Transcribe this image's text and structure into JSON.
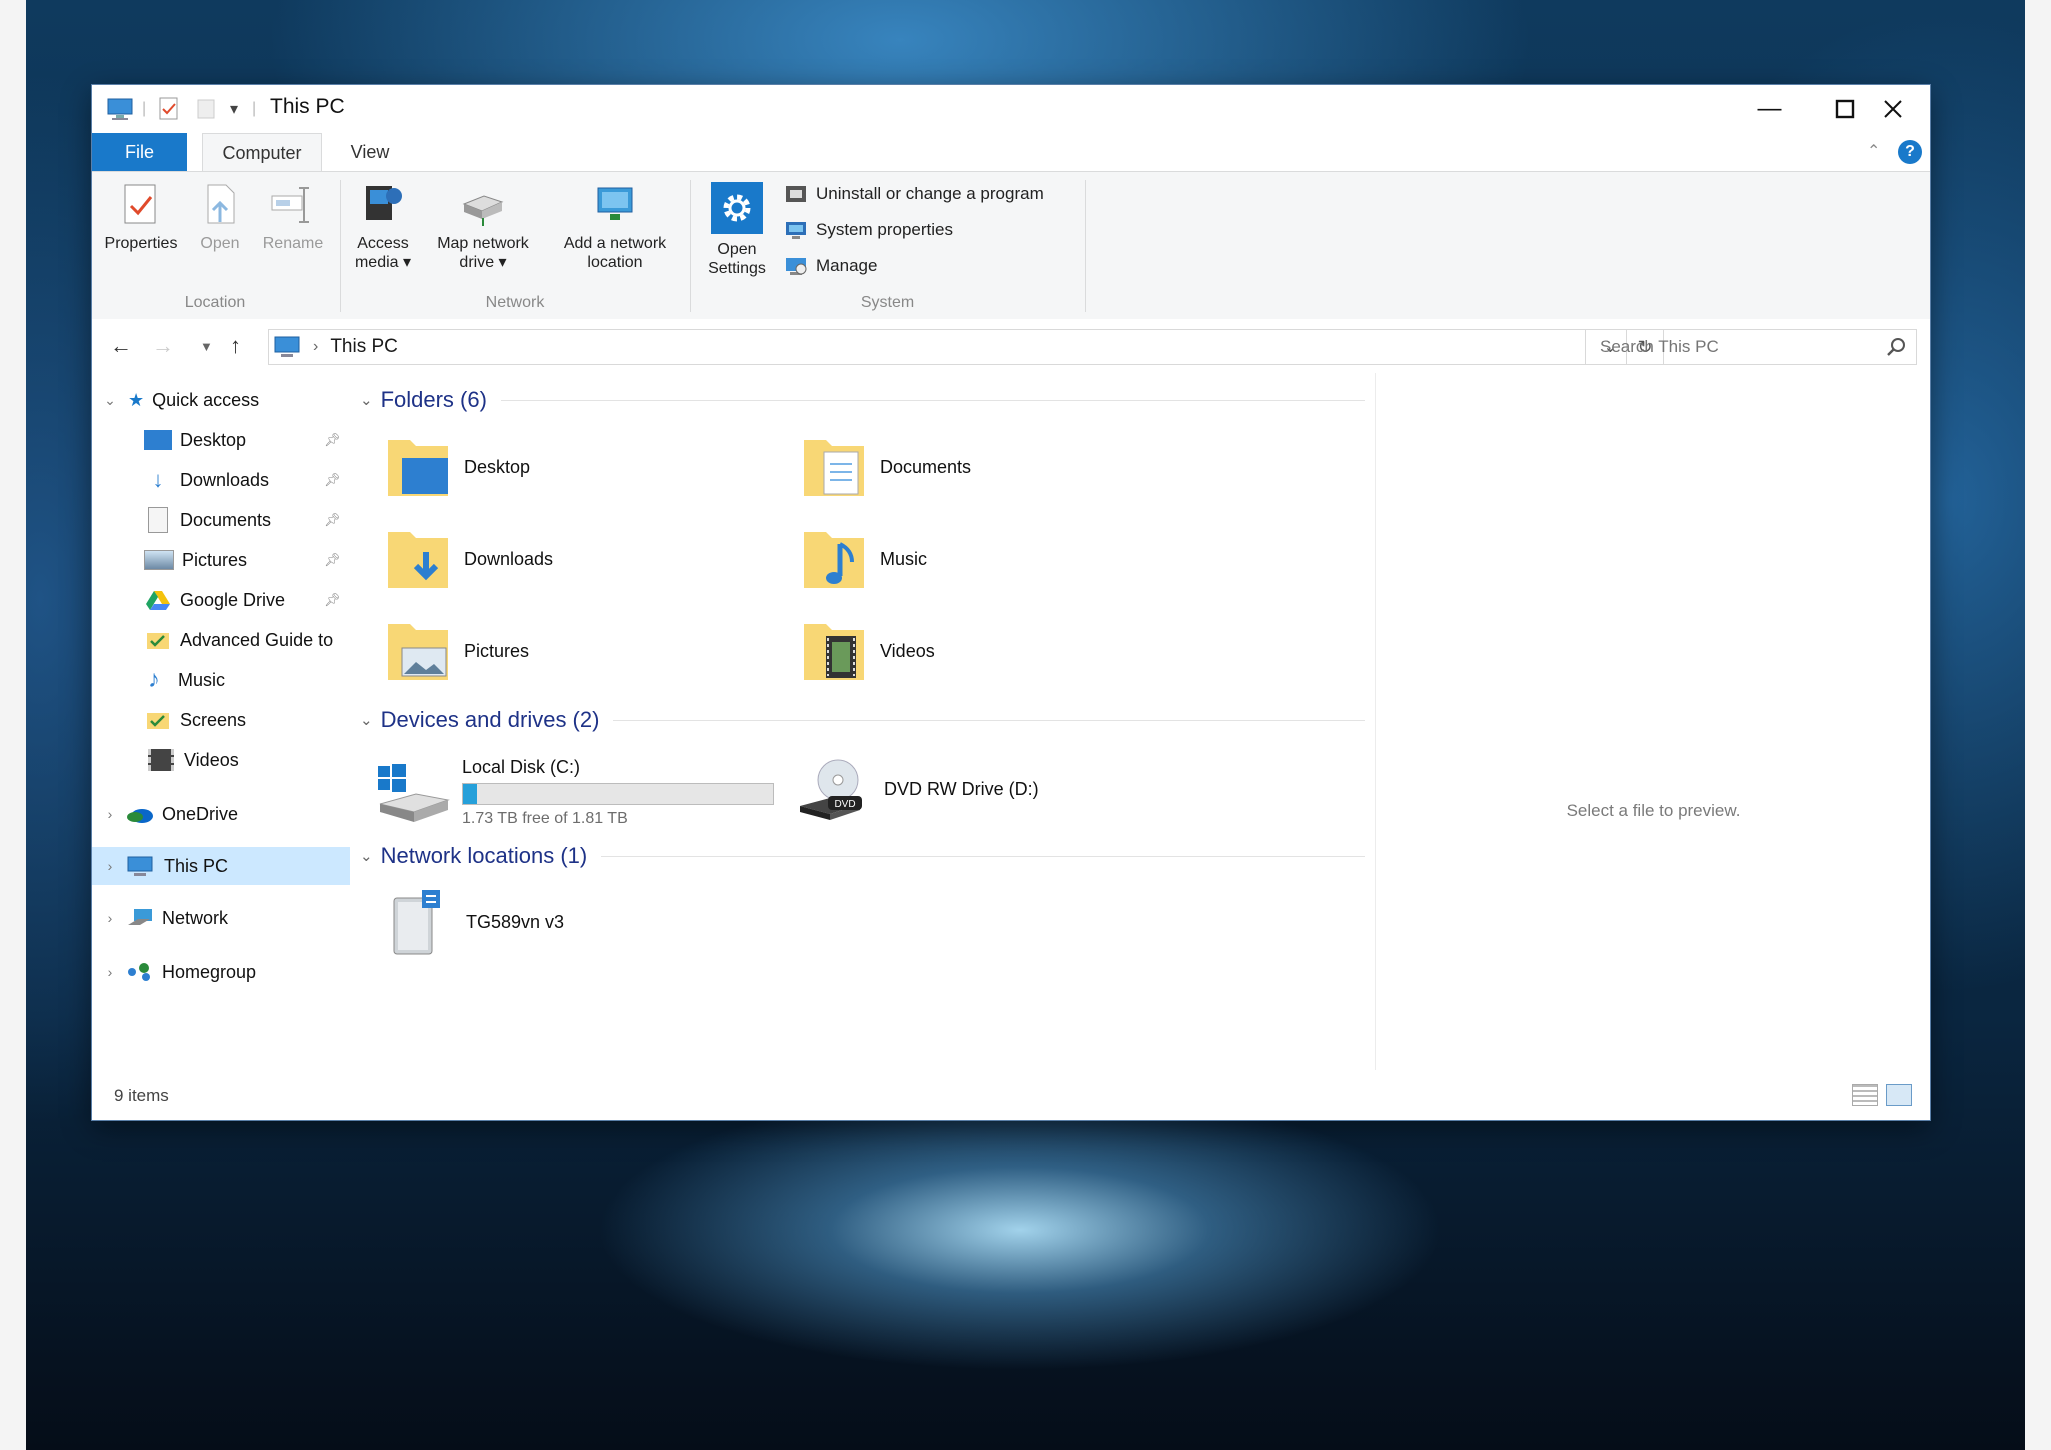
{
  "window": {
    "title": "This PC"
  },
  "ribbon": {
    "tabs": [
      "File",
      "Computer",
      "View"
    ],
    "location": {
      "group_label": "Location",
      "properties": "Properties",
      "open": "Open",
      "rename": "Rename"
    },
    "network": {
      "group_label": "Network",
      "access_media": [
        "Access",
        "media ▾"
      ],
      "map_drive": [
        "Map network",
        "drive ▾"
      ],
      "add_location": [
        "Add a network",
        "location"
      ]
    },
    "system": {
      "group_label": "System",
      "open_settings": [
        "Open",
        "Settings"
      ],
      "uninstall": "Uninstall or change a program",
      "system_properties": "System properties",
      "manage": "Manage"
    }
  },
  "address": {
    "path": "This PC",
    "search_placeholder": "Search This PC"
  },
  "navpane": {
    "quick_access": "Quick access",
    "quick_items": [
      "Desktop",
      "Downloads",
      "Documents",
      "Pictures",
      "Google Drive",
      "Advanced Guide to",
      "Music",
      "Screens",
      "Videos"
    ],
    "onedrive": "OneDrive",
    "this_pc": "This PC",
    "network": "Network",
    "homegroup": "Homegroup"
  },
  "content": {
    "folders_header": "Folders (6)",
    "folders": [
      "Desktop",
      "Documents",
      "Downloads",
      "Music",
      "Pictures",
      "Videos"
    ],
    "devices_header": "Devices and drives (2)",
    "local_disk": {
      "name": "Local Disk (C:)",
      "free_text": "1.73 TB free of 1.81 TB",
      "used_fraction": 0.044
    },
    "dvd": "DVD RW Drive (D:)",
    "network_header": "Network locations (1)",
    "network_item": "TG589vn v3"
  },
  "preview": {
    "message": "Select a file to preview."
  },
  "status": {
    "items": "9 items"
  },
  "colors": {
    "accent": "#1979ca",
    "section_header": "#1e3287",
    "selection": "#cce8ff",
    "folder": "#f8d775"
  }
}
